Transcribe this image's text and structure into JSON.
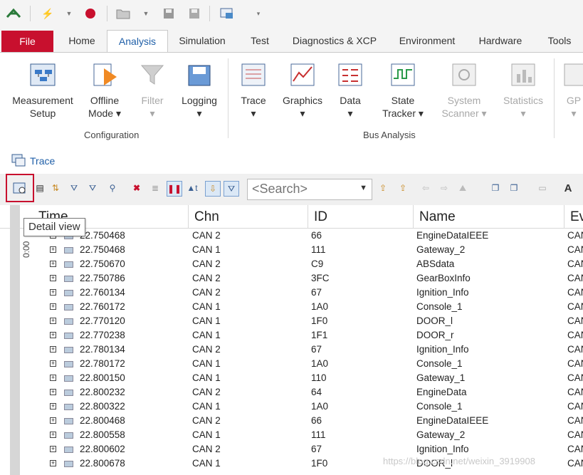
{
  "colors": {
    "accent": "#1f5fa8",
    "file_tab": "#c8102e",
    "highlight": "#c8102e"
  },
  "quick_access": {
    "icons": [
      "app-icon",
      "flash-icon",
      "dropdown-icon",
      "record-icon",
      "open-folder-icon",
      "dropdown-icon",
      "save-icon",
      "save-as-icon",
      "config-icon",
      "customize-icon"
    ]
  },
  "tabs": [
    {
      "label": "File"
    },
    {
      "label": "Home"
    },
    {
      "label": "Analysis"
    },
    {
      "label": "Simulation"
    },
    {
      "label": "Test"
    },
    {
      "label": "Diagnostics & XCP"
    },
    {
      "label": "Environment"
    },
    {
      "label": "Hardware"
    },
    {
      "label": "Tools"
    }
  ],
  "ribbon": {
    "configuration": {
      "label": "Configuration",
      "buttons": [
        {
          "label": "Measurement",
          "label2": "Setup"
        },
        {
          "label": "Offline",
          "label2": "Mode ▾"
        },
        {
          "label": "Filter",
          "label2": "▾"
        },
        {
          "label": "Logging",
          "label2": "▾"
        }
      ]
    },
    "bus_analysis": {
      "label": "Bus Analysis",
      "buttons": [
        {
          "label": "Trace",
          "label2": "▾"
        },
        {
          "label": "Graphics",
          "label2": "▾"
        },
        {
          "label": "Data",
          "label2": "▾"
        },
        {
          "label": "State",
          "label2": "Tracker ▾"
        },
        {
          "label": "System",
          "label2": "Scanner ▾"
        },
        {
          "label": "Statistics",
          "label2": "▾"
        },
        {
          "label": "GP",
          "label2": "▾"
        }
      ]
    }
  },
  "trace_window": {
    "title": "Trace",
    "search_placeholder": "<Search>",
    "tooltip": "Detail view",
    "time_label": "0:00",
    "columns": [
      "Time",
      "Chn",
      "ID",
      "Name",
      "Ev"
    ],
    "rows": [
      {
        "time": "22.750468",
        "chn": "CAN 2",
        "id": "66",
        "name": "EngineDataIEEE",
        "ev": "CAN"
      },
      {
        "time": "22.750468",
        "chn": "CAN 1",
        "id": "111",
        "name": "Gateway_2",
        "ev": "CAN"
      },
      {
        "time": "22.750670",
        "chn": "CAN 2",
        "id": "C9",
        "name": "ABSdata",
        "ev": "CAN"
      },
      {
        "time": "22.750786",
        "chn": "CAN 2",
        "id": "3FC",
        "name": "GearBoxInfo",
        "ev": "CAN"
      },
      {
        "time": "22.760134",
        "chn": "CAN 2",
        "id": "67",
        "name": "Ignition_Info",
        "ev": "CAN"
      },
      {
        "time": "22.760172",
        "chn": "CAN 1",
        "id": "1A0",
        "name": "Console_1",
        "ev": "CAN"
      },
      {
        "time": "22.770120",
        "chn": "CAN 1",
        "id": "1F0",
        "name": "DOOR_l",
        "ev": "CAN"
      },
      {
        "time": "22.770238",
        "chn": "CAN 1",
        "id": "1F1",
        "name": "DOOR_r",
        "ev": "CAN"
      },
      {
        "time": "22.780134",
        "chn": "CAN 2",
        "id": "67",
        "name": "Ignition_Info",
        "ev": "CAN"
      },
      {
        "time": "22.780172",
        "chn": "CAN 1",
        "id": "1A0",
        "name": "Console_1",
        "ev": "CAN"
      },
      {
        "time": "22.800150",
        "chn": "CAN 1",
        "id": "110",
        "name": "Gateway_1",
        "ev": "CAN"
      },
      {
        "time": "22.800232",
        "chn": "CAN 2",
        "id": "64",
        "name": "EngineData",
        "ev": "CAN"
      },
      {
        "time": "22.800322",
        "chn": "CAN 1",
        "id": "1A0",
        "name": "Console_1",
        "ev": "CAN"
      },
      {
        "time": "22.800468",
        "chn": "CAN 2",
        "id": "66",
        "name": "EngineDataIEEE",
        "ev": "CAN"
      },
      {
        "time": "22.800558",
        "chn": "CAN 1",
        "id": "111",
        "name": "Gateway_2",
        "ev": "CAN"
      },
      {
        "time": "22.800602",
        "chn": "CAN 2",
        "id": "67",
        "name": "Ignition_Info",
        "ev": "CAN"
      },
      {
        "time": "22.800678",
        "chn": "CAN 1",
        "id": "1F0",
        "name": "DOOR_l",
        "ev": "CAN"
      }
    ]
  },
  "watermark": "https://blog.csdn.net/weixin_3919908"
}
